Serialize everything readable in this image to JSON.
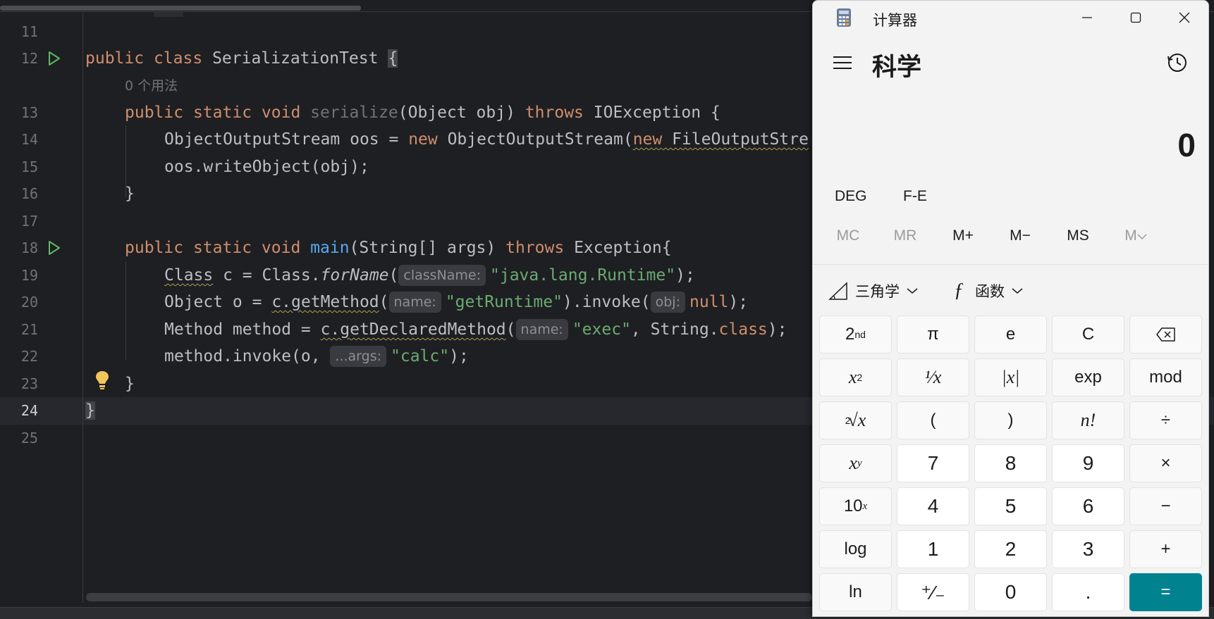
{
  "editor": {
    "line_numbers": [
      "11",
      "12",
      "13",
      "14",
      "15",
      "16",
      "17",
      "18",
      "19",
      "20",
      "21",
      "22",
      "23",
      "24",
      "25"
    ],
    "usage_hint": "0 个用法",
    "code": {
      "l12": {
        "kw1": "public",
        "kw2": "class",
        "name": "SerializationTest",
        "brace": "{"
      },
      "l13": {
        "kw1": "public",
        "kw2": "static",
        "kw3": "void",
        "method": "serialize",
        "params": "(Object obj)",
        "kw4": "throws",
        "rest": "IOException {"
      },
      "l14": {
        "a": "ObjectOutputStream oos = ",
        "kw": "new",
        "b": " ObjectOutputStream(",
        "kw2": "new",
        "c": " FileOutputStre"
      },
      "l15": {
        "a": "oos.writeObject(obj);"
      },
      "l16": {
        "a": "}"
      },
      "l18": {
        "kw1": "public",
        "kw2": "static",
        "kw3": "void",
        "method": "main",
        "params": "(String[] args)",
        "kw4": "throws",
        "rest": "Exception{"
      },
      "l19": {
        "type": "Class",
        "a": " c = Class.",
        "call": "forName",
        "b": "(",
        "hint": "className:",
        "str": "\"java.lang.Runtime\"",
        "end": ");"
      },
      "l20": {
        "a": "Object o = ",
        "call": "c.getMethod",
        "b": "(",
        "hint": "name:",
        "str": "\"getRuntime\"",
        "c": ").invoke(",
        "hint2": "obj:",
        "kw": "null",
        "end": ");"
      },
      "l21": {
        "a": "Method method = ",
        "call": "c.getDeclaredMethod",
        "b": "(",
        "hint": "name:",
        "str": "\"exec\"",
        "c": ", String.",
        "kw": "class",
        "end": ");"
      },
      "l22": {
        "a": "method.invoke(o, ",
        "hint": "...args:",
        "str": "\"calc\"",
        "end": ");"
      },
      "l23": {
        "a": "}"
      },
      "l24": {
        "a": "}"
      }
    },
    "colors": {
      "background": "#1e1f22",
      "keyword": "#cf8e6d",
      "function": "#56a8f5",
      "string": "#6aab73",
      "text": "#bcbec4"
    }
  },
  "calculator": {
    "title": "计算器",
    "mode": "科学",
    "display_value": "0",
    "angle_unit": "DEG",
    "fe_label": "F-E",
    "memory": [
      "MC",
      "MR",
      "M+",
      "M−",
      "MS",
      "M"
    ],
    "trig_label": "三角学",
    "func_label": "函数",
    "keys": {
      "r1": [
        "2",
        "π",
        "e",
        "C",
        "backspace"
      ],
      "r2": [
        "x",
        "¹⁄x",
        "|x|",
        "exp",
        "mod"
      ],
      "r3": [
        "√x",
        "(",
        ")",
        "n!",
        "÷"
      ],
      "r4": [
        "x",
        "7",
        "8",
        "9",
        "×"
      ],
      "r5": [
        "10",
        "4",
        "5",
        "6",
        "−"
      ],
      "r6": [
        "log",
        "1",
        "2",
        "3",
        "+"
      ],
      "r7": [
        "ln",
        "⁺⁄₋",
        "0",
        ".",
        "="
      ]
    },
    "colors": {
      "background": "#f3f3f3",
      "equals": "#00838f",
      "number_key": "#ffffff",
      "function_key": "#f9f9f9"
    }
  }
}
